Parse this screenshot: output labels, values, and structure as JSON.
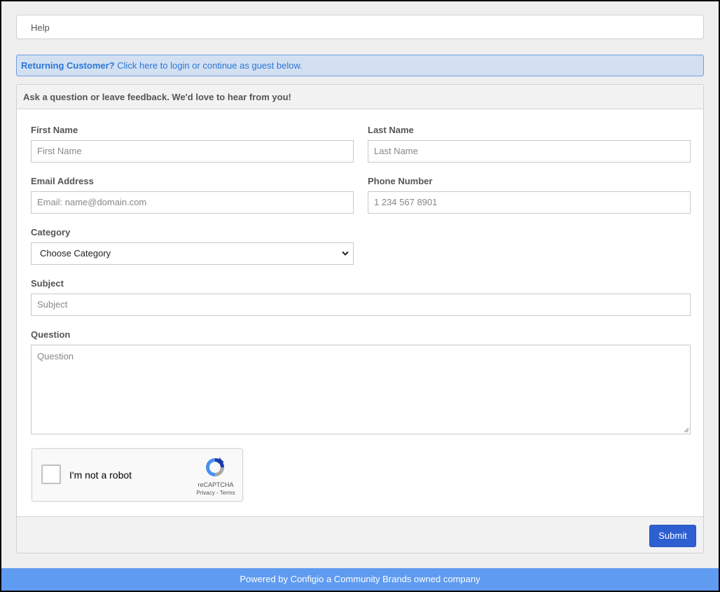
{
  "breadcrumb": {
    "label": "Help"
  },
  "alert": {
    "bold_text": "Returning Customer?",
    "link_text": "Click here to login or continue as guest below."
  },
  "panel": {
    "heading": "Ask a question or leave feedback. We'd love to hear from you!"
  },
  "form": {
    "first_name": {
      "label": "First Name",
      "placeholder": "First Name",
      "value": ""
    },
    "last_name": {
      "label": "Last Name",
      "placeholder": "Last Name",
      "value": ""
    },
    "email": {
      "label": "Email Address",
      "placeholder": "Email: name@domain.com",
      "value": ""
    },
    "phone": {
      "label": "Phone Number",
      "placeholder": "1 234 567 8901",
      "value": ""
    },
    "category": {
      "label": "Category",
      "selected": "Choose Category"
    },
    "subject": {
      "label": "Subject",
      "placeholder": "Subject",
      "value": ""
    },
    "question": {
      "label": "Question",
      "placeholder": "Question",
      "value": ""
    }
  },
  "recaptcha": {
    "label": "I'm not a robot",
    "brand": "reCAPTCHA",
    "privacy": "Privacy",
    "separator": " - ",
    "terms": "Terms",
    "checked": false
  },
  "actions": {
    "submit_label": "Submit"
  },
  "footer": {
    "text": "Powered by Configio a Community Brands owned company"
  },
  "colors": {
    "alert_bg": "#d3e0f2",
    "alert_text": "#2a76d4",
    "submit_bg": "#2e5fd1",
    "footer_bg": "#5f9bf0"
  },
  "icons": {
    "select_arrow": "chevron-down-icon",
    "recaptcha_logo": "recaptcha-logo-icon",
    "textarea_resize": "resize-grip-icon"
  }
}
